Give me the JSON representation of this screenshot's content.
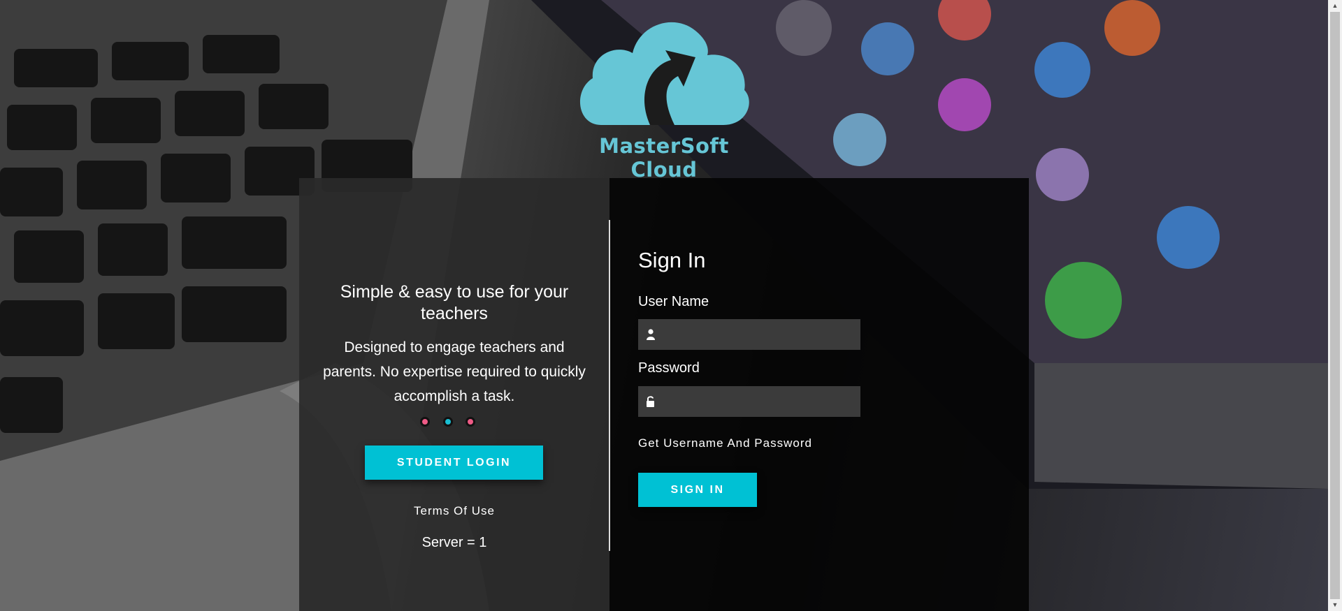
{
  "brand": {
    "name": "MasterSoft Cloud",
    "accent": "#66c6d6"
  },
  "promo": {
    "headline": "Simple & easy to use for your teachers",
    "description": "Designed to engage teachers and parents. No expertise required to quickly accomplish a task.",
    "carousel_dots": [
      {
        "color": "#ef5b86"
      },
      {
        "color": "#19bfd2"
      },
      {
        "color": "#ef5b86"
      }
    ],
    "student_login_label": "STUDENT LOGIN",
    "terms_label": "Terms Of Use",
    "server_text": "Server = 1"
  },
  "signin": {
    "title": "Sign In",
    "username": {
      "label": "User Name",
      "value": "",
      "placeholder": "",
      "icon": "user-icon"
    },
    "password": {
      "label": "Password",
      "value": "",
      "placeholder": "",
      "icon": "lock-icon"
    },
    "forgot_label": "Get Username And Password",
    "submit_label": "SIGN IN"
  },
  "colors": {
    "button": "#00c1d4",
    "panel_left": "#2a2a2a",
    "panel_right": "#040404",
    "field": "#3b3b3b"
  }
}
